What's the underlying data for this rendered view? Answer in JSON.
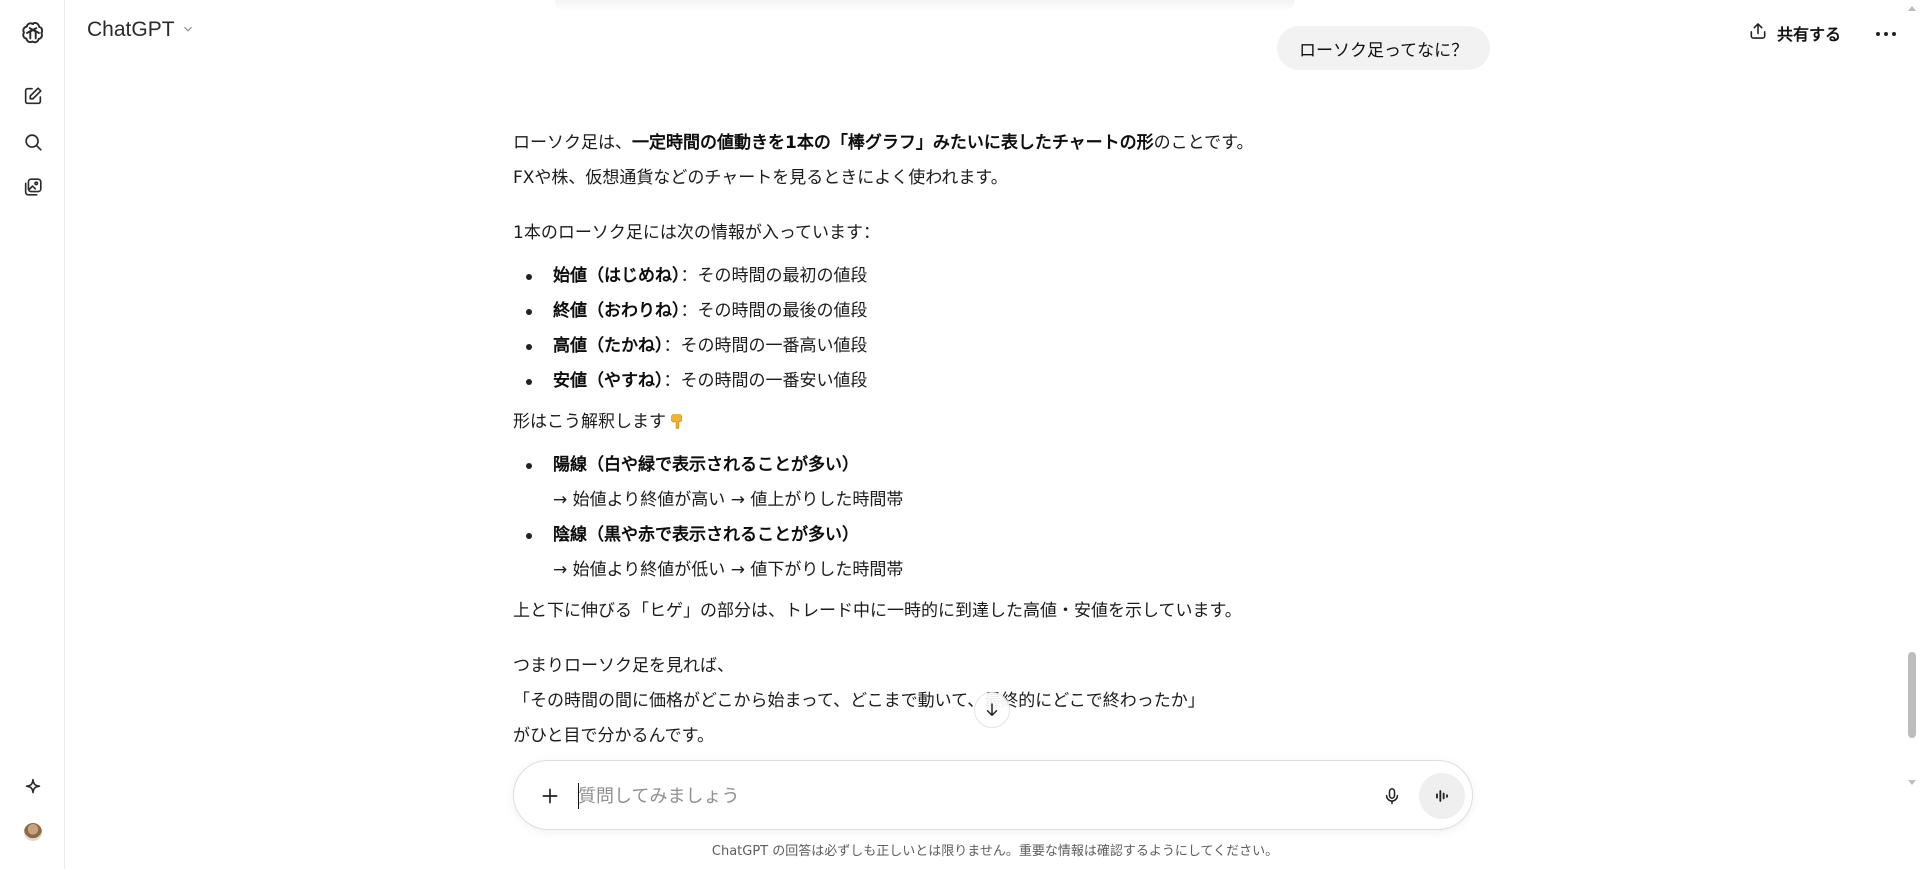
{
  "header": {
    "model_name": "ChatGPT",
    "share_label": "共有する"
  },
  "sidebar": {
    "items": [
      {
        "name": "openai-logo",
        "icon": "openai-logo-icon"
      },
      {
        "name": "new-chat",
        "icon": "edit-icon"
      },
      {
        "name": "search",
        "icon": "search-icon"
      },
      {
        "name": "library",
        "icon": "images-icon"
      },
      {
        "name": "explore-gpts",
        "icon": "sparkle-icon"
      },
      {
        "name": "profile",
        "icon": "avatar"
      }
    ]
  },
  "user_message": "ローソク足ってなに？",
  "assistant": {
    "intro_1_pre": "ローソク足は、",
    "intro_1_bold": "一定時間の値動きを1本の「棒グラフ」みたいに表したチャートの形",
    "intro_1_post": "のことです。",
    "intro_2": "FXや株、仮想通貨などのチャートを見るときによく使われます。",
    "info_heading": "1本のローソク足には次の情報が入っています：",
    "info_items": [
      {
        "bold": "始値（はじめね）",
        "text": "：その時間の最初の値段"
      },
      {
        "bold": "終値（おわりね）",
        "text": "：その時間の最後の値段"
      },
      {
        "bold": "高値（たかね）",
        "text": "：その時間の一番高い値段"
      },
      {
        "bold": "安値（やすね）",
        "text": "：その時間の一番安い値段"
      }
    ],
    "shape_heading": "形はこう解釈します",
    "shape_items": [
      {
        "bold": "陽線（白や緑で表示されることが多い）",
        "sub": "→ 始値より終値が高い → 値上がりした時間帯"
      },
      {
        "bold": "陰線（黒や赤で表示されることが多い）",
        "sub": "→ 始値より終値が低い → 値下がりした時間帯"
      }
    ],
    "wick_text": "上と下に伸びる「ヒゲ」の部分は、トレード中に一時的に到達した高値・安値を示しています。",
    "summary_1": "つまりローソク足を見れば、",
    "summary_2": "「その時間の間に価格がどこから始まって、どこまで動いて、最終的にどこで終わったか」",
    "summary_3": "がひと目で分かるんです。"
  },
  "composer": {
    "placeholder": "質問してみましょう",
    "value": ""
  },
  "disclaimer": "ChatGPT の回答は必ずしも正しいとは限りません。重要な情報は確認するようにしてください。"
}
